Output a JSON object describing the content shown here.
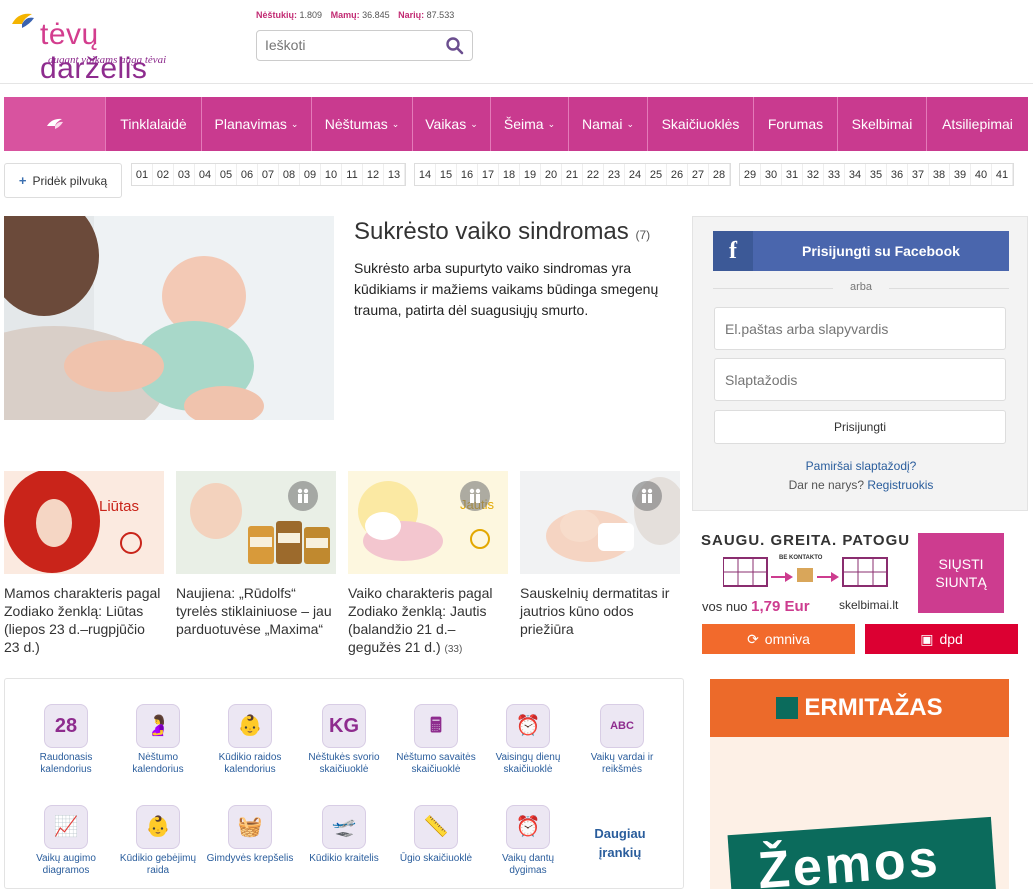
{
  "brand": {
    "name_part1": "tėvų",
    "name_part2": "darželis",
    "tagline": "augant vaikams auga tėvai"
  },
  "stats": [
    {
      "label": "Nėštukių:",
      "value": "1.809"
    },
    {
      "label": "Mamų:",
      "value": "36.845"
    },
    {
      "label": "Narių:",
      "value": "87.533"
    }
  ],
  "search": {
    "placeholder": "Ieškoti"
  },
  "nav": [
    {
      "label": "Tinklalaidė",
      "dropdown": false
    },
    {
      "label": "Planavimas",
      "dropdown": true
    },
    {
      "label": "Nėštumas",
      "dropdown": true
    },
    {
      "label": "Vaikas",
      "dropdown": true
    },
    {
      "label": "Šeima",
      "dropdown": true
    },
    {
      "label": "Namai",
      "dropdown": true
    },
    {
      "label": "Skaičiuoklės",
      "dropdown": false
    },
    {
      "label": "Forumas",
      "dropdown": false
    },
    {
      "label": "Skelbimai",
      "dropdown": false
    },
    {
      "label": "Atsiliepimai",
      "dropdown": false
    }
  ],
  "add_belly": "Pridėk pilvuką",
  "weeks": {
    "group1": [
      "01",
      "02",
      "03",
      "04",
      "05",
      "06",
      "07",
      "08",
      "09",
      "10",
      "11",
      "12",
      "13"
    ],
    "group2": [
      "14",
      "15",
      "16",
      "17",
      "18",
      "19",
      "20",
      "21",
      "22",
      "23",
      "24",
      "25",
      "26",
      "27",
      "28"
    ],
    "group3": [
      "29",
      "30",
      "31",
      "32",
      "33",
      "34",
      "35",
      "36",
      "37",
      "38",
      "39",
      "40",
      "41"
    ]
  },
  "featured": {
    "title": "Sukrėsto vaiko sindromas",
    "comments": "(7)",
    "text": "Sukrėsto arba supurtyto vaiko sindromas yra kūdikiams ir mažiems vaikams būdinga smegenų trauma, patirta dėl suagusiųjų smurto."
  },
  "articles": [
    {
      "title": "Mamos charakteris pagal Zodiako ženklą: Liūtas (liepos 23 d.–rugpjūčio 23 d.)",
      "comments": "",
      "image_text": "Liūtas"
    },
    {
      "title": "Naujiena: „Rūdolfs“ tyrelės stiklainiuose – jau parduotuvėse „Maxima“",
      "comments": "",
      "image_text": ""
    },
    {
      "title": "Vaiko charakteris pagal Zodiako ženklą: Jautis (balandžio 21 d.–gegužės 21 d.)",
      "comments": "(33)",
      "image_text": "Jautis"
    },
    {
      "title": "Sauskelnių dermatitas ir jautrios kūno odos priežiūra",
      "comments": "",
      "image_text": ""
    }
  ],
  "login": {
    "facebook": "Prisijungti su Facebook",
    "or": "arba",
    "email_placeholder": "El.paštas arba slapyvardis",
    "password_placeholder": "Slaptažodis",
    "submit": "Prisijungti",
    "forgot": "Pamiršai slaptažodį?",
    "not_member": "Dar ne narys?",
    "register": "Registruokis"
  },
  "ad": {
    "headline": "SAUGU. GREITA. PATOGU",
    "contactless": "BE KONTAKTO",
    "cta": "SIŲSTI SIUNTĄ",
    "price_prefix": "vos nuo",
    "price": "1,79 Eur",
    "site": "skelbimai.lt",
    "omniva": "omniva",
    "dpd": "dpd"
  },
  "tools": [
    {
      "label": "Raudonasis kalendorius",
      "icon": "calendar-icon",
      "badge": "28"
    },
    {
      "label": "Nėštumo kalendorius",
      "icon": "pregnancy-icon",
      "badge": ""
    },
    {
      "label": "Kūdikio raidos kalendorius",
      "icon": "baby-head-icon",
      "badge": ""
    },
    {
      "label": "Nėštukės svorio skaičiuoklė",
      "icon": "scale-icon",
      "badge": "KG"
    },
    {
      "label": "Nėštumo savaitės skaičiuoklė",
      "icon": "calculator-icon",
      "badge": ""
    },
    {
      "label": "Vaisingų dienų skaičiuoklė",
      "icon": "ovulation-icon",
      "badge": ""
    },
    {
      "label": "Vaikų vardai ir reikšmės",
      "icon": "abc-blocks-icon",
      "badge": ""
    },
    {
      "label": "Vaikų augimo diagramos",
      "icon": "growth-chart-icon",
      "badge": ""
    },
    {
      "label": "Kūdikio gebėjimų raida",
      "icon": "development-icon",
      "badge": ""
    },
    {
      "label": "Gimdyvės krepšelis",
      "icon": "basket-icon",
      "badge": ""
    },
    {
      "label": "Kūdikio kraitelis",
      "icon": "stroller-icon",
      "badge": ""
    },
    {
      "label": "Ūgio skaičiuoklė",
      "icon": "height-icon",
      "badge": ""
    },
    {
      "label": "Vaikų dantų dygimas",
      "icon": "teeth-alarm-icon",
      "badge": ""
    }
  ],
  "more_tools": "Daugiau įrankių",
  "erm_ad": {
    "brand": "ERMITAŽAS",
    "text": "Žemos"
  },
  "colors": {
    "brand_pink": "#c93a8f",
    "brand_purple": "#8e2c8e",
    "link_blue": "#2a5d9c",
    "facebook": "#4a66ad",
    "omniva": "#f26a2c",
    "dpd": "#dc0032"
  }
}
